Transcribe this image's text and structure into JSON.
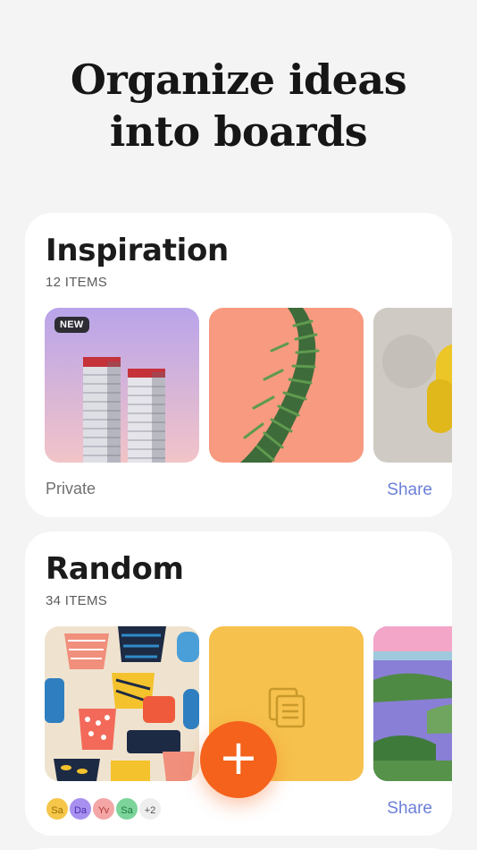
{
  "headline": {
    "line1": "Organize ideas",
    "line2": "into boards"
  },
  "boards": [
    {
      "title": "Inspiration",
      "count": "12 ITEMS",
      "badge": "NEW",
      "privacy": "Private",
      "share": "Share"
    },
    {
      "title": "Random",
      "count": "34 ITEMS",
      "share": "Share",
      "collaborators": [
        {
          "initials": "Sa",
          "color": "#f5c64a",
          "text": "#9a6b00"
        },
        {
          "initials": "Da",
          "color": "#a890f0",
          "text": "#4a2fb0"
        },
        {
          "initials": "Yv",
          "color": "#f4a6a6",
          "text": "#b13a3a"
        },
        {
          "initials": "Sa",
          "color": "#7cd49a",
          "text": "#1e7a3e"
        },
        {
          "initials": "+2",
          "color": "#eeeeee",
          "text": "#555555"
        }
      ]
    }
  ],
  "fab": {
    "label": "+",
    "accent": "#f4621b"
  },
  "colors": {
    "share": "#6b7fd8",
    "note_tile": "#f6c14d"
  }
}
